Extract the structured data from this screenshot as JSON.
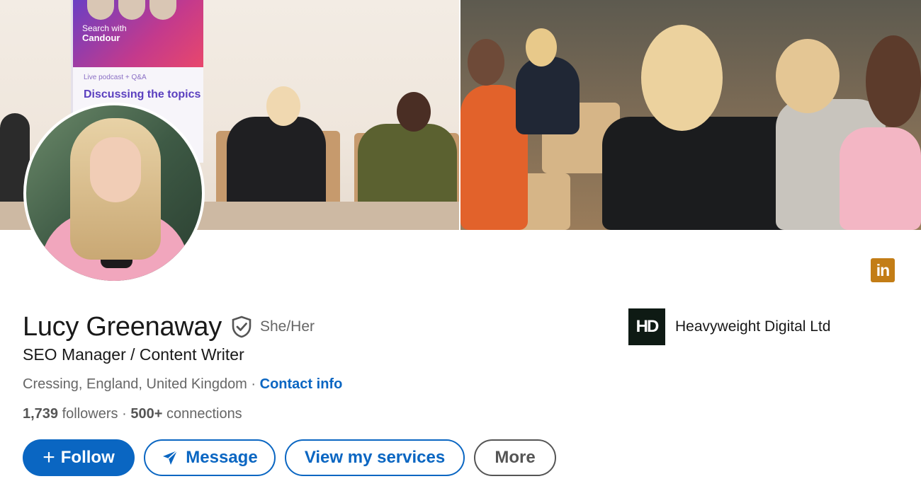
{
  "banner": {
    "rollup_search_line1": "Search with",
    "rollup_search_line2": "Candour",
    "rollup_small": "Live podcast + Q&A",
    "rollup_big": "Discussing the topics"
  },
  "profile": {
    "name": "Lucy Greenaway",
    "verified_icon": "verified-shield-icon",
    "pronouns": "She/Her",
    "headline": "SEO Manager / Content Writer",
    "location": "Cressing, England, United Kingdom",
    "location_sep": " · ",
    "contact_label": "Contact info",
    "followers_count": "1,739",
    "followers_label": " followers",
    "stats_sep": " · ",
    "connections_count": "500+",
    "connections_label": " connections"
  },
  "company": {
    "logo_text": "HD",
    "name": "Heavyweight Digital Ltd"
  },
  "linkedin_badge": "in",
  "actions": {
    "follow_plus": "+",
    "follow_label": "Follow",
    "message_label": "Message",
    "services_label": "View my services",
    "more_label": "More"
  },
  "colors": {
    "brand_blue": "#0a66c2",
    "badge_gold": "#c37d16",
    "text_primary": "#191919",
    "text_secondary": "#666666"
  }
}
